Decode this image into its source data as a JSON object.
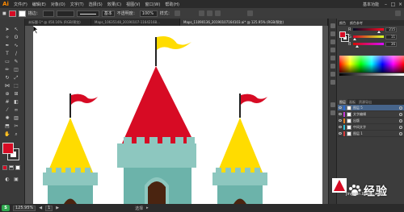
{
  "app": {
    "logo": "Ai"
  },
  "menu": {
    "items": [
      "文件(F)",
      "编辑(E)",
      "对象(O)",
      "文字(T)",
      "选择(S)",
      "效果(C)",
      "视图(V)",
      "窗口(W)",
      "帮助(H)"
    ],
    "workspace": "基本功能"
  },
  "control": {
    "stroke_label": "描边：",
    "profile_label": "基本",
    "opacity_label": "不透明度：",
    "opacity_value": "100%",
    "style_label": "样式："
  },
  "tabs": [
    {
      "label": "未标题-1* @ 450.16% (RGB/预览)",
      "active": false
    },
    {
      "label": "Maps_10635148_20190107-11642168...",
      "active": false
    },
    {
      "label": "Maps_11090136_20190107164103.ai* @ 125.95% (RGB/预览)",
      "active": true
    }
  ],
  "colors": {
    "fill": "#d70b24",
    "castle_teal": "#8dc7bf",
    "castle_teal_dark": "#6cb3aa",
    "roof_red": "#d70b24",
    "roof_yellow": "#ffdc00",
    "door_brown": "#4a2410",
    "flag_red": "#d70b24",
    "flag_yellow": "#ffdc00",
    "canvas_bg": "#535353"
  },
  "color_panel": {
    "tabs": [
      "颜色",
      "颜色参考"
    ],
    "sliders": [
      {
        "label": "R",
        "value": "215",
        "color": "#d70b24",
        "level": 0.84
      },
      {
        "label": "G",
        "value": "11",
        "color": "#1a8a1a",
        "level": 0.04
      },
      {
        "label": "B",
        "value": "36",
        "color": "#2a3fd0",
        "level": 0.14
      }
    ]
  },
  "layers_panel": {
    "tabs": [
      "图层",
      "画板",
      "资源导出"
    ],
    "rows": [
      {
        "name": "图层 5",
        "color": "#2a6ad6",
        "selected": true
      },
      {
        "name": "文字编辑",
        "color": "#c73bd6",
        "selected": false
      },
      {
        "name": "出版",
        "color": "#e07a20",
        "selected": false
      },
      {
        "name": "中间文字",
        "color": "#2ac0d6",
        "selected": false
      },
      {
        "name": "图层 1",
        "color": "#d63b3b",
        "selected": false
      }
    ]
  },
  "status": {
    "zoom": "125.95%",
    "artboard_number": "1",
    "tool_label": "选择"
  },
  "watermark": {
    "text": "经验",
    "brand": "Bai",
    "sub": "jingyan.baidu.com"
  },
  "taskbar": {
    "ime": "S"
  }
}
